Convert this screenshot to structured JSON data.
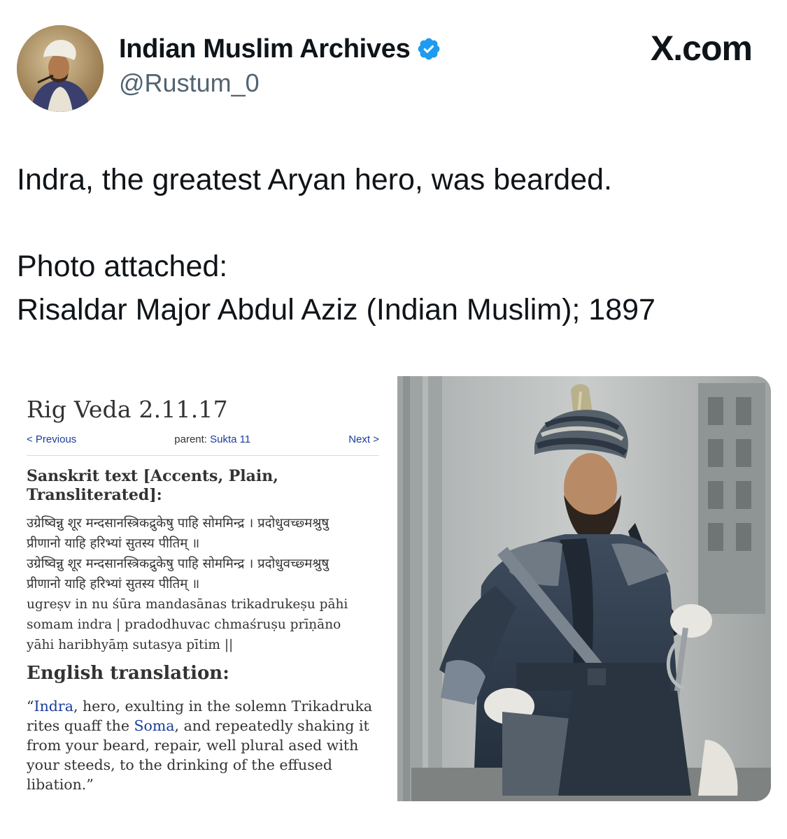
{
  "author": {
    "display_name": "Indian Muslim Archives",
    "handle": "@Rustum_0",
    "verified": true,
    "verified_color": "#1d9bf0"
  },
  "brand": {
    "label": "X.com"
  },
  "tweet": {
    "line1": "Indra, the greatest Aryan hero, was bearded.",
    "line2": "Photo attached:",
    "line3": "Risaldar Major Abdul Aziz (Indian Muslim); 1897"
  },
  "vedic_page": {
    "title": "Rig Veda 2.11.17",
    "nav": {
      "previous": "< Previous",
      "parent_prefix": "parent: ",
      "parent_link": "Sukta 11",
      "next": "Next >"
    },
    "sanskrit_heading": "Sanskrit text [Accents, Plain, Transliterated]:",
    "sanskrit_lines": [
      "उग्रेष्विन्नु शूर मन्दसानस्त्रिकद्रुकेषु पाहि सोममिन्द्र । प्रदोधुवच्छ्मश्रुषु",
      "प्रीणानो याहि हरिभ्यां सुतस्य पीतिम् ॥",
      "उग्रेष्विन्नु शूर मन्दसानस्त्रिकद्रुकेषु पाहि सोममिन्द्र । प्रदोधुवच्छ्मश्रुषु",
      "प्रीणानो याहि हरिभ्यां सुतस्य पीतिम् ॥",
      "ugreṣv in nu śūra mandasānas trikadrukeṣu pāhi",
      "somam indra | pradodhuvac chmaśruṣu prīṇāno",
      "yāhi haribhyāṃ sutasya pītim ||"
    ],
    "english_heading": "English translation:",
    "translation": {
      "open_quote": "“",
      "link1": "Indra",
      "part1": ", hero, exulting in the solemn Trikadruka rites quaff the ",
      "link2": "Soma",
      "part2": ", and repeatedly shaking it from your beard, repair, well plural ased with your steeds, to the drinking of the effused libation.”"
    },
    "link_color": "#1a3d9c"
  },
  "photo": {
    "icon": "portrait-photo"
  }
}
